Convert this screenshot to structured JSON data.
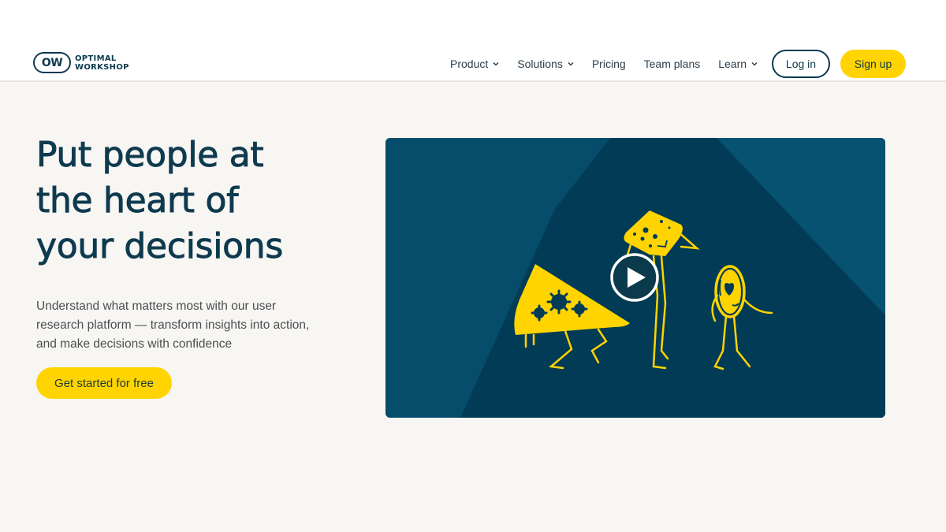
{
  "header": {
    "logo": {
      "badge": "OW",
      "line1": "OPTIMAL",
      "line2": "WORKSHOP"
    },
    "nav": [
      {
        "label": "Product",
        "has_dropdown": true
      },
      {
        "label": "Solutions",
        "has_dropdown": true
      },
      {
        "label": "Pricing",
        "has_dropdown": false
      },
      {
        "label": "Team plans",
        "has_dropdown": false
      },
      {
        "label": "Learn",
        "has_dropdown": true
      }
    ],
    "login_label": "Log in",
    "signup_label": "Sign up"
  },
  "hero": {
    "title_lines": [
      "Put people at",
      "the heart of",
      "your decisions"
    ],
    "subtitle_lines": [
      "Understand what matters most with our user",
      "research platform — transform insights into action,",
      "and make decisions with confidence"
    ],
    "cta_label": "Get started for free"
  },
  "video": {
    "play_icon": "play-icon",
    "illustration": "three-yellow-doodle-characters"
  },
  "colors": {
    "brand_navy": "#0e3a4f",
    "accent_yellow": "#ffd400",
    "page_bg": "#f8f6f3",
    "video_bg": "#064d6b",
    "video_bg_dark": "#023a54"
  }
}
